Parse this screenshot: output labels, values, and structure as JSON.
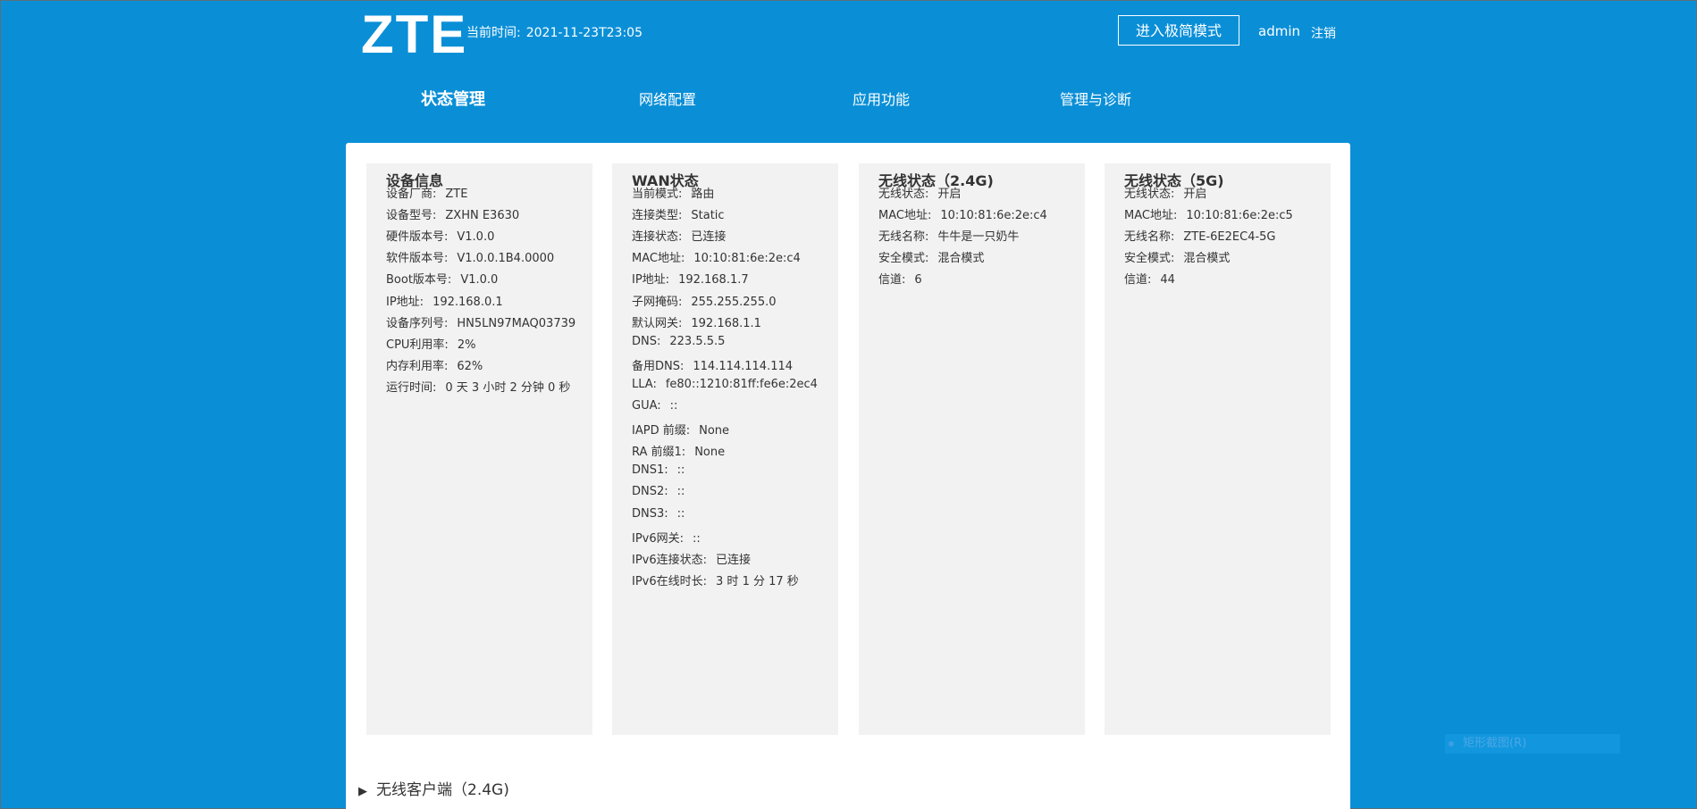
{
  "header": {
    "logo": "ZTE",
    "time_label": "当前时间:",
    "time_value": "2021-11-23T23:05",
    "mode_button": "进入极简模式",
    "user": "admin",
    "logout": "注销"
  },
  "nav": [
    {
      "label": "状态管理",
      "active": true
    },
    {
      "label": "网络配置",
      "active": false
    },
    {
      "label": "应用功能",
      "active": false
    },
    {
      "label": "管理与诊断",
      "active": false
    }
  ],
  "cards": [
    {
      "title": "设备信息",
      "rows": [
        {
          "k": "设备厂商:",
          "v": "ZTE"
        },
        {
          "k": "设备型号:",
          "v": "ZXHN E3630"
        },
        {
          "k": "硬件版本号:",
          "v": "V1.0.0"
        },
        {
          "k": "软件版本号:",
          "v": "V1.0.0.1B4.0000"
        },
        {
          "k": "Boot版本号:",
          "v": "V1.0.0"
        },
        {
          "k": "IP地址:",
          "v": "192.168.0.1"
        },
        {
          "k": "设备序列号:",
          "v": "HN5LN97MAQ03739"
        },
        {
          "k": "CPU利用率:",
          "v": "2%"
        },
        {
          "k": "内存利用率:",
          "v": "62%"
        },
        {
          "k": "运行时间:",
          "v": "0 天 3 小时 2 分钟 0 秒"
        }
      ]
    },
    {
      "title": "WAN状态",
      "rows": [
        {
          "k": "当前模式:",
          "v": "路由"
        },
        {
          "k": "连接类型:",
          "v": "Static"
        },
        {
          "k": "连接状态:",
          "v": "已连接"
        },
        {
          "k": "MAC地址:",
          "v": "10:10:81:6e:2e:c4"
        },
        {
          "k": "IP地址:",
          "v": "192.168.1.7"
        },
        {
          "k": "子网掩码:",
          "v": "255.255.255.0"
        },
        {
          "k": "默认网关:",
          "v": "192.168.1.1"
        },
        {
          "k": "DNS:",
          "v": "223.5.5.5"
        },
        {
          "k": "备用DNS:",
          "v": "114.114.114.114"
        },
        {
          "k": "LLA:",
          "v": "fe80::1210:81ff:fe6e:2ec4"
        },
        {
          "k": "GUA:",
          "v": "::"
        },
        {
          "k": "IAPD 前缀:",
          "v": "None"
        },
        {
          "k": "RA 前缀1:",
          "v": "None"
        },
        {
          "k": "DNS1:",
          "v": "::"
        },
        {
          "k": "DNS2:",
          "v": "::"
        },
        {
          "k": "DNS3:",
          "v": "::"
        },
        {
          "k": "IPv6网关:",
          "v": "::"
        },
        {
          "k": "IPv6连接状态:",
          "v": "已连接"
        },
        {
          "k": "IPv6在线时长:",
          "v": "3 时 1 分 17 秒"
        }
      ]
    },
    {
      "title": "无线状态（2.4G)",
      "rows": [
        {
          "k": "无线状态:",
          "v": "开启"
        },
        {
          "k": "MAC地址:",
          "v": "10:10:81:6e:2e:c4"
        },
        {
          "k": "无线名称:",
          "v": "牛牛是一只奶牛"
        },
        {
          "k": "安全模式:",
          "v": "混合模式"
        },
        {
          "k": "信道:",
          "v": "6"
        }
      ]
    },
    {
      "title": "无线状态（5G)",
      "rows": [
        {
          "k": "无线状态:",
          "v": "开启"
        },
        {
          "k": "MAC地址:",
          "v": "10:10:81:6e:2e:c5"
        },
        {
          "k": "无线名称:",
          "v": "ZTE-6E2EC4-5G"
        },
        {
          "k": "安全模式:",
          "v": "混合模式"
        },
        {
          "k": "信道:",
          "v": "44"
        }
      ]
    }
  ],
  "client_section": {
    "arrow": "▶",
    "label": "无线客户端（2.4G)"
  },
  "watermark": "矩形截图(R)"
}
